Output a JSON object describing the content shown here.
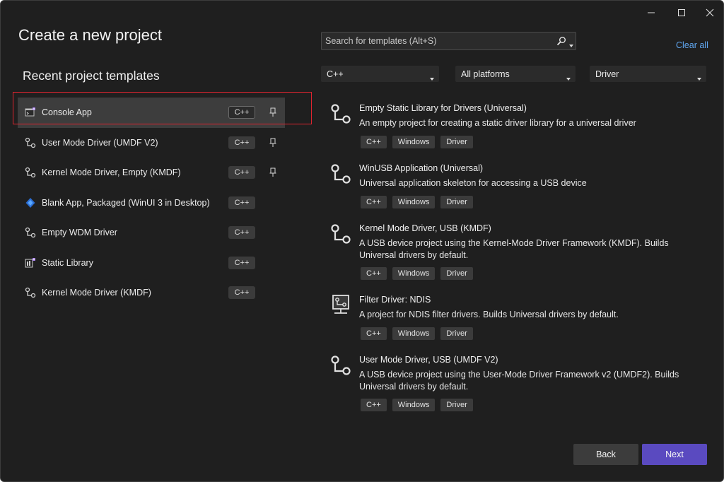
{
  "window": {
    "controls": [
      "minimize-icon",
      "maximize-icon",
      "close-icon"
    ]
  },
  "page_title": "Create a new project",
  "recent": {
    "title": "Recent project templates",
    "items": [
      {
        "label": "Console App",
        "tag": "C++",
        "icon": "console-app-icon",
        "pinned": true,
        "selected": true
      },
      {
        "label": "User Mode Driver (UMDF V2)",
        "tag": "C++",
        "icon": "driver-icon",
        "pinned": true
      },
      {
        "label": "Kernel Mode Driver, Empty (KMDF)",
        "tag": "C++",
        "icon": "driver-icon",
        "pinned": true
      },
      {
        "label": "Blank App, Packaged (WinUI 3 in Desktop)",
        "tag": "C++",
        "icon": "winui-icon",
        "pinned": false
      },
      {
        "label": "Empty WDM Driver",
        "tag": "C++",
        "icon": "driver-icon",
        "pinned": false
      },
      {
        "label": "Static Library",
        "tag": "C++",
        "icon": "static-library-icon",
        "pinned": false
      },
      {
        "label": "Kernel Mode Driver (KMDF)",
        "tag": "C++",
        "icon": "driver-icon",
        "pinned": false
      }
    ]
  },
  "search": {
    "placeholder": "Search for templates (Alt+S)",
    "value": ""
  },
  "clear_all": "Clear all",
  "filters": {
    "language": "C++",
    "platform": "All platforms",
    "project_type": "Driver"
  },
  "results": [
    {
      "name": "Empty Static Library for Drivers (Universal)",
      "description": "An empty project for creating a static driver library for a universal driver",
      "tags": [
        "C++",
        "Windows",
        "Driver"
      ],
      "icon": "driver-icon"
    },
    {
      "name": "WinUSB Application (Universal)",
      "description": "Universal application skeleton for accessing a USB device",
      "tags": [
        "C++",
        "Windows",
        "Driver"
      ],
      "icon": "driver-icon"
    },
    {
      "name": "Kernel Mode Driver, USB (KMDF)",
      "description": "A USB device project using the Kernel-Mode Driver Framework (KMDF). Builds Universal drivers by default.",
      "tags": [
        "C++",
        "Windows",
        "Driver"
      ],
      "icon": "driver-icon"
    },
    {
      "name": "Filter Driver: NDIS",
      "description": "A project for NDIS filter drivers. Builds Universal drivers by default.",
      "tags": [
        "C++",
        "Windows",
        "Driver"
      ],
      "icon": "ndis-filter-icon"
    },
    {
      "name": "User Mode Driver, USB (UMDF V2)",
      "description": "A USB device project using the User-Mode Driver Framework v2 (UMDF2). Builds Universal drivers by default.",
      "tags": [
        "C++",
        "Windows",
        "Driver"
      ],
      "icon": "driver-icon"
    }
  ],
  "buttons": {
    "back": "Back",
    "next": "Next"
  }
}
